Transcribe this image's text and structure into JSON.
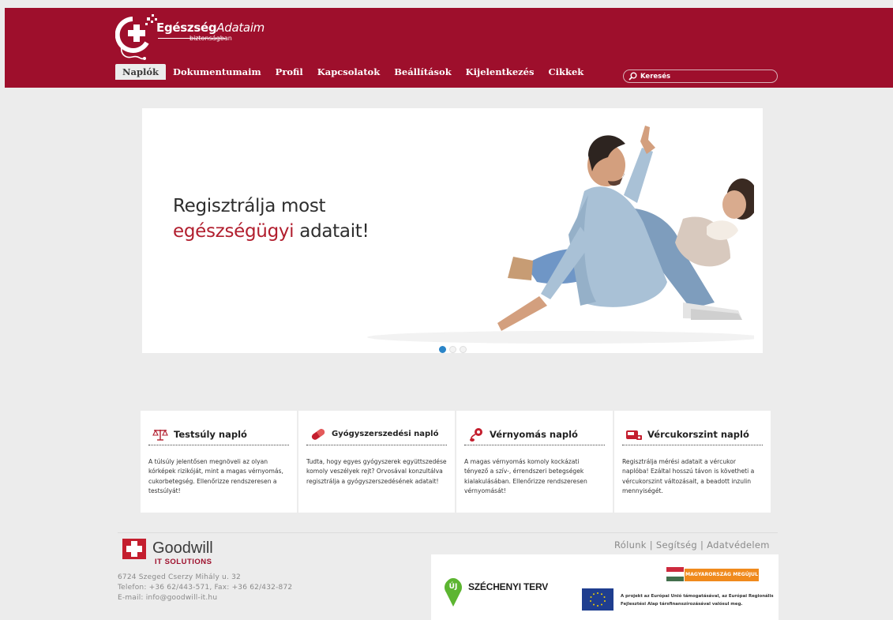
{
  "brand": {
    "title_bold": "Egészség",
    "title_italic": "Adataim",
    "subtitle": "biztonságban"
  },
  "nav": {
    "items": [
      "Naplók",
      "Dokumentumaim",
      "Profil",
      "Kapcsolatok",
      "Beállítások",
      "Kijelentkezés",
      "Cikkek"
    ],
    "active_index": 0
  },
  "search": {
    "placeholder": "Keresés"
  },
  "banner": {
    "line1": "Regisztrálja most",
    "highlight": "egészségügyi",
    "line2_rest": " adatait!",
    "slides_total": 3,
    "active_slide": 1
  },
  "cards": [
    {
      "icon": "scale-icon",
      "title": "Testsúly napló",
      "text": "A túlsúly jelentősen megnöveli az olyan kórképek rizikóját, mint a magas vérnyomás, cukorbetegség. Ellenőrizze rendszeresen a testsúlyát!"
    },
    {
      "icon": "pill-icon",
      "title": "Gyógyszerszedési napló",
      "text": "Tudta, hogy egyes gyógyszerek együttszedése komoly veszélyek rejt? Orvosával konzultálva regisztrálja a gyógyszerszedésének adatait!"
    },
    {
      "icon": "blood-pressure-icon",
      "title": "Vérnyomás napló",
      "text": "A magas vérnyomás komoly kockázati tényező a szív-, érrendszeri betegségek kialakulásában. Ellenőrizze rendszeresen vérnyomását!"
    },
    {
      "icon": "glucose-meter-icon",
      "title": "Vércukorszint napló",
      "text": "Regisztrálja mérési adatait a vércukor naplóba! Ezáltal hosszú távon is követheti a vércukorszint változásait, a beadott inzulin mennyiségét."
    }
  ],
  "footer": {
    "company_name": "Goodwill",
    "company_sub": "IT SOLUTIONS",
    "address": "6724 Szeged Cserzy Mihály u. 32",
    "phone": "Telefon: +36 62/443-571, Fax: +36 62/432-872",
    "email": "E-mail: info@goodwill-it.hu",
    "links": [
      "Rólunk",
      "Segítség",
      "Adatvédelem"
    ],
    "separator": "|"
  },
  "sponsor": {
    "szechenyi_text": "SZÉCHENYI TERV",
    "szechenyi_mark": "ÚJ",
    "hu_label": "MAGYARORSZÁG MEGÚJUL",
    "eu_text": "A projekt az Európai Unió támogatásával, az Európai Regionális Fejlesztési Alap társfinanszírozásával valósul meg."
  },
  "colors": {
    "brand_red": "#9e0f2c",
    "page_bg": "#ececec",
    "slider_active": "#2a85c8",
    "highlight_red": "#b11e2e"
  }
}
